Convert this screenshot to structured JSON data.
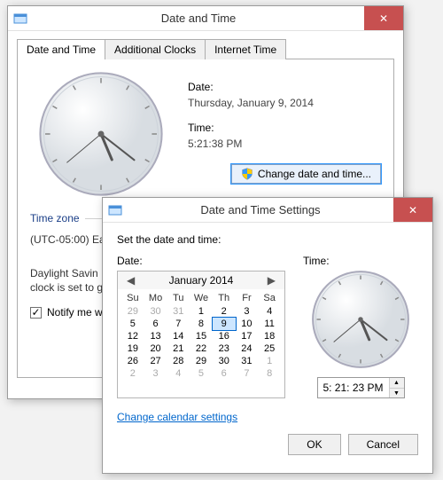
{
  "dlg1": {
    "title": "Date and Time",
    "tabs": [
      "Date and Time",
      "Additional Clocks",
      "Internet Time"
    ],
    "active_tab": 0,
    "date_label": "Date:",
    "date_value": "Thursday, January 9, 2014",
    "time_label": "Time:",
    "time_value": "5:21:38 PM",
    "change_btn": "Change date and time...",
    "tz_legend": "Time zone",
    "tz_value": "(UTC-05:00) Ea",
    "dst_text1": "Daylight Savin",
    "dst_text2": "clock is set to g",
    "notify_label": "Notify me w",
    "notify_checked": true
  },
  "dlg2": {
    "title": "Date and Time Settings",
    "prompt": "Set the date and time:",
    "date_label": "Date:",
    "time_label": "Time:",
    "calendar": {
      "title": "January 2014",
      "dow": [
        "Su",
        "Mo",
        "Tu",
        "We",
        "Th",
        "Fr",
        "Sa"
      ],
      "cells": [
        {
          "n": 29,
          "other": true
        },
        {
          "n": 30,
          "other": true
        },
        {
          "n": 31,
          "other": true
        },
        {
          "n": 1
        },
        {
          "n": 2
        },
        {
          "n": 3
        },
        {
          "n": 4
        },
        {
          "n": 5
        },
        {
          "n": 6
        },
        {
          "n": 7
        },
        {
          "n": 8
        },
        {
          "n": 9,
          "sel": true
        },
        {
          "n": 10
        },
        {
          "n": 11
        },
        {
          "n": 12
        },
        {
          "n": 13
        },
        {
          "n": 14
        },
        {
          "n": 15
        },
        {
          "n": 16
        },
        {
          "n": 17
        },
        {
          "n": 18
        },
        {
          "n": 19
        },
        {
          "n": 20
        },
        {
          "n": 21
        },
        {
          "n": 22
        },
        {
          "n": 23
        },
        {
          "n": 24
        },
        {
          "n": 25
        },
        {
          "n": 26
        },
        {
          "n": 27
        },
        {
          "n": 28
        },
        {
          "n": 29
        },
        {
          "n": 30
        },
        {
          "n": 31
        },
        {
          "n": 1,
          "other": true
        },
        {
          "n": 2,
          "other": true
        },
        {
          "n": 3,
          "other": true
        },
        {
          "n": 4,
          "other": true
        },
        {
          "n": 5,
          "other": true
        },
        {
          "n": 6,
          "other": true
        },
        {
          "n": 7,
          "other": true
        },
        {
          "n": 8,
          "other": true
        }
      ]
    },
    "time_value": "5: 21: 23 PM",
    "change_cal_link": "Change calendar settings",
    "ok": "OK",
    "cancel": "Cancel"
  },
  "clock": {
    "hour_angle": 157,
    "minute_angle": 128,
    "second_angle": 230
  }
}
